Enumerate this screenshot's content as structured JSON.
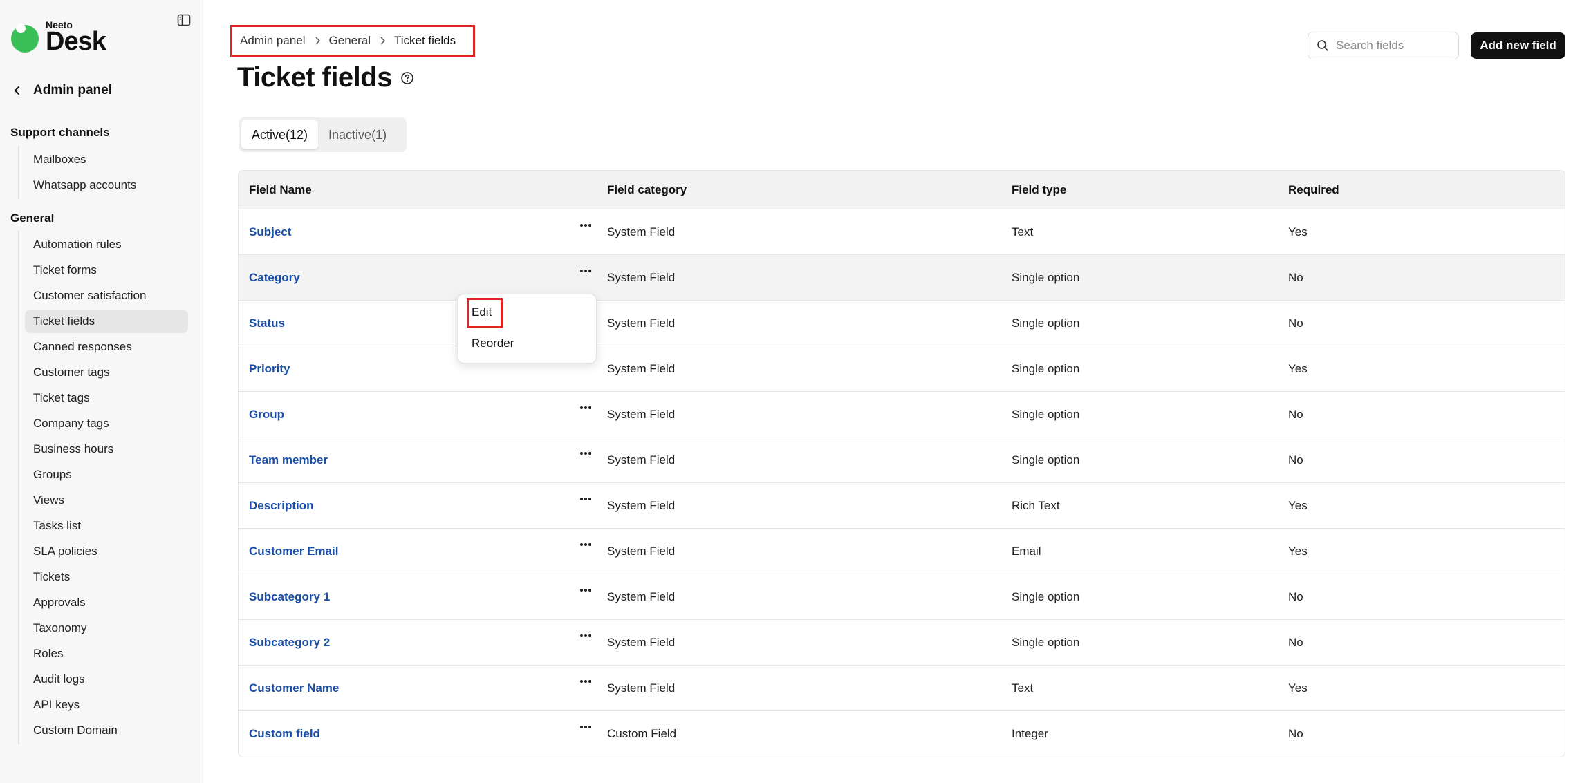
{
  "app": {
    "logo_small": "Neeto",
    "logo_big": "Desk"
  },
  "sidebar": {
    "back_label": "Admin panel",
    "sections": [
      {
        "title": "Support channels",
        "items": [
          "Mailboxes",
          "Whatsapp accounts"
        ]
      },
      {
        "title": "General",
        "items": [
          "Automation rules",
          "Ticket forms",
          "Customer satisfaction",
          "Ticket fields",
          "Canned responses",
          "Customer tags",
          "Ticket tags",
          "Company tags",
          "Business hours",
          "Groups",
          "Views",
          "Tasks list",
          "SLA policies",
          "Tickets",
          "Approvals",
          "Taxonomy",
          "Roles",
          "Audit logs",
          "API keys",
          "Custom Domain"
        ]
      }
    ],
    "active_item": "Ticket fields"
  },
  "breadcrumb": [
    "Admin panel",
    "General",
    "Ticket fields"
  ],
  "page": {
    "title": "Ticket fields"
  },
  "search": {
    "placeholder": "Search fields"
  },
  "add_button": "Add new field",
  "tabs": [
    {
      "label": "Active(12)",
      "active": true
    },
    {
      "label": "Inactive(1)",
      "active": false
    }
  ],
  "table": {
    "columns": [
      "Field Name",
      "Field category",
      "Field type",
      "Required"
    ],
    "rows": [
      [
        "Subject",
        "System Field",
        "Text",
        "Yes"
      ],
      [
        "Category",
        "System Field",
        "Single option",
        "No"
      ],
      [
        "Status",
        "System Field",
        "Single option",
        "No"
      ],
      [
        "Priority",
        "System Field",
        "Single option",
        "Yes"
      ],
      [
        "Group",
        "System Field",
        "Single option",
        "No"
      ],
      [
        "Team member",
        "System Field",
        "Single option",
        "No"
      ],
      [
        "Description",
        "System Field",
        "Rich Text",
        "Yes"
      ],
      [
        "Customer Email",
        "System Field",
        "Email",
        "Yes"
      ],
      [
        "Subcategory 1",
        "System Field",
        "Single option",
        "No"
      ],
      [
        "Subcategory 2",
        "System Field",
        "Single option",
        "No"
      ],
      [
        "Customer Name",
        "System Field",
        "Text",
        "Yes"
      ],
      [
        "Custom field",
        "Custom Field",
        "Integer",
        "No"
      ]
    ],
    "hover_row": 1
  },
  "dropdown_menu": {
    "items": [
      "Edit",
      "Reorder"
    ]
  },
  "colors": {
    "accent": "#3bbf57",
    "link": "#1a4fa8",
    "highlight": "#e02424",
    "primary_button": "#111111"
  },
  "icons": [
    "sidebar-collapse-icon",
    "chevron-left-icon",
    "chevron-right-icon",
    "help-circle-icon",
    "search-icon",
    "more-horizontal-icon"
  ]
}
